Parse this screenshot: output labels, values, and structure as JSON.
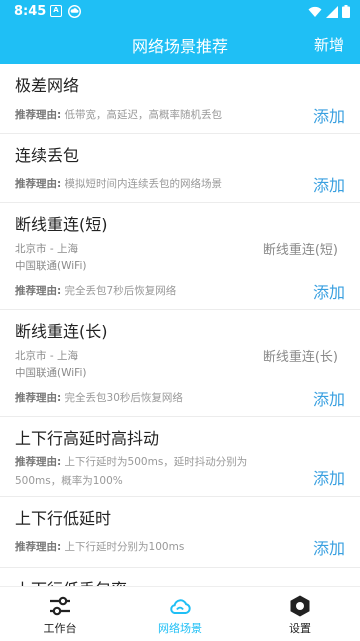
{
  "status_bar": {
    "time": "8:45",
    "icons": [
      "a-icon",
      "cloud-icon",
      "wifi-icon",
      "signal-icon",
      "battery-icon"
    ]
  },
  "app_bar": {
    "title": "网络场景推荐",
    "action": "新增"
  },
  "scenes": [
    {
      "name": "极差网络",
      "reason_label": "推荐理由:",
      "reason_text": "低带宽，高延迟，高概率随机丢包",
      "add": "添加"
    },
    {
      "name": "连续丢包",
      "reason_label": "推荐理由:",
      "reason_text": "模拟短时间内连续丢包的网络场景",
      "add": "添加"
    },
    {
      "name": "断线重连(短)",
      "location": "北京市 - 上海",
      "network": "中国联通(WiFi)",
      "tag": "断线重连(短)",
      "reason_label": "推荐理由:",
      "reason_text": "完全丢包7秒后恢复网络",
      "add": "添加"
    },
    {
      "name": "断线重连(长)",
      "location": "北京市 - 上海",
      "network": "中国联通(WiFi)",
      "tag": "断线重连(长)",
      "reason_label": "推荐理由:",
      "reason_text": "完全丢包30秒后恢复网络",
      "add": "添加"
    },
    {
      "name": "上下行高延时高抖动",
      "reason_label": "推荐理由:",
      "reason_text": "上下行延时为500ms，延时抖动分别为500ms，概率为100%",
      "add": "添加"
    },
    {
      "name": "上下行低延时",
      "reason_label": "推荐理由:",
      "reason_text": "上下行延时分别为100ms",
      "add": "添加"
    },
    {
      "name": "上下行低丢包率"
    }
  ],
  "bottom_nav": [
    {
      "label": "工作台",
      "icon": "sliders-icon"
    },
    {
      "label": "网络场景",
      "icon": "cloud-icon",
      "active": true
    },
    {
      "label": "设置",
      "icon": "gear-icon"
    }
  ],
  "colors": {
    "primary": "#1fbff5",
    "add_link": "#3aa0e0"
  }
}
